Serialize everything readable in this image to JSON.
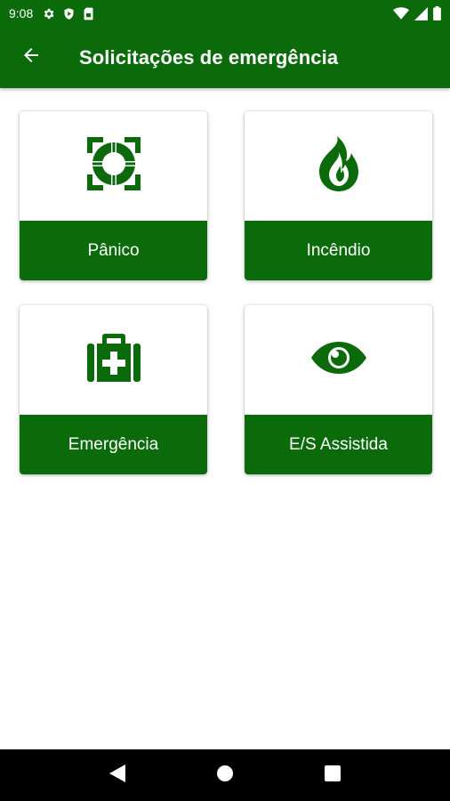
{
  "status_bar": {
    "time": "9:08",
    "left_icons": [
      "gear-icon",
      "play-shield-icon",
      "sim-card-icon"
    ],
    "right_icons": [
      "wifi-icon",
      "signal-icon",
      "battery-icon"
    ]
  },
  "app_bar": {
    "title": "Solicitações de emergência",
    "back_icon": "arrow-left-icon"
  },
  "cards": [
    {
      "label": "Pânico",
      "icon": "lifebuoy-icon"
    },
    {
      "label": "Incêndio",
      "icon": "fire-icon"
    },
    {
      "label": "Emergência",
      "icon": "first-aid-kit-icon"
    },
    {
      "label": "E/S Assistida",
      "icon": "eye-icon"
    }
  ],
  "nav_bar": {
    "buttons": [
      "back-triangle-icon",
      "home-circle-icon",
      "recents-square-icon"
    ]
  },
  "colors": {
    "primary": "#0b6b0b",
    "background": "#ffffff",
    "nav_bar": "#000000"
  }
}
